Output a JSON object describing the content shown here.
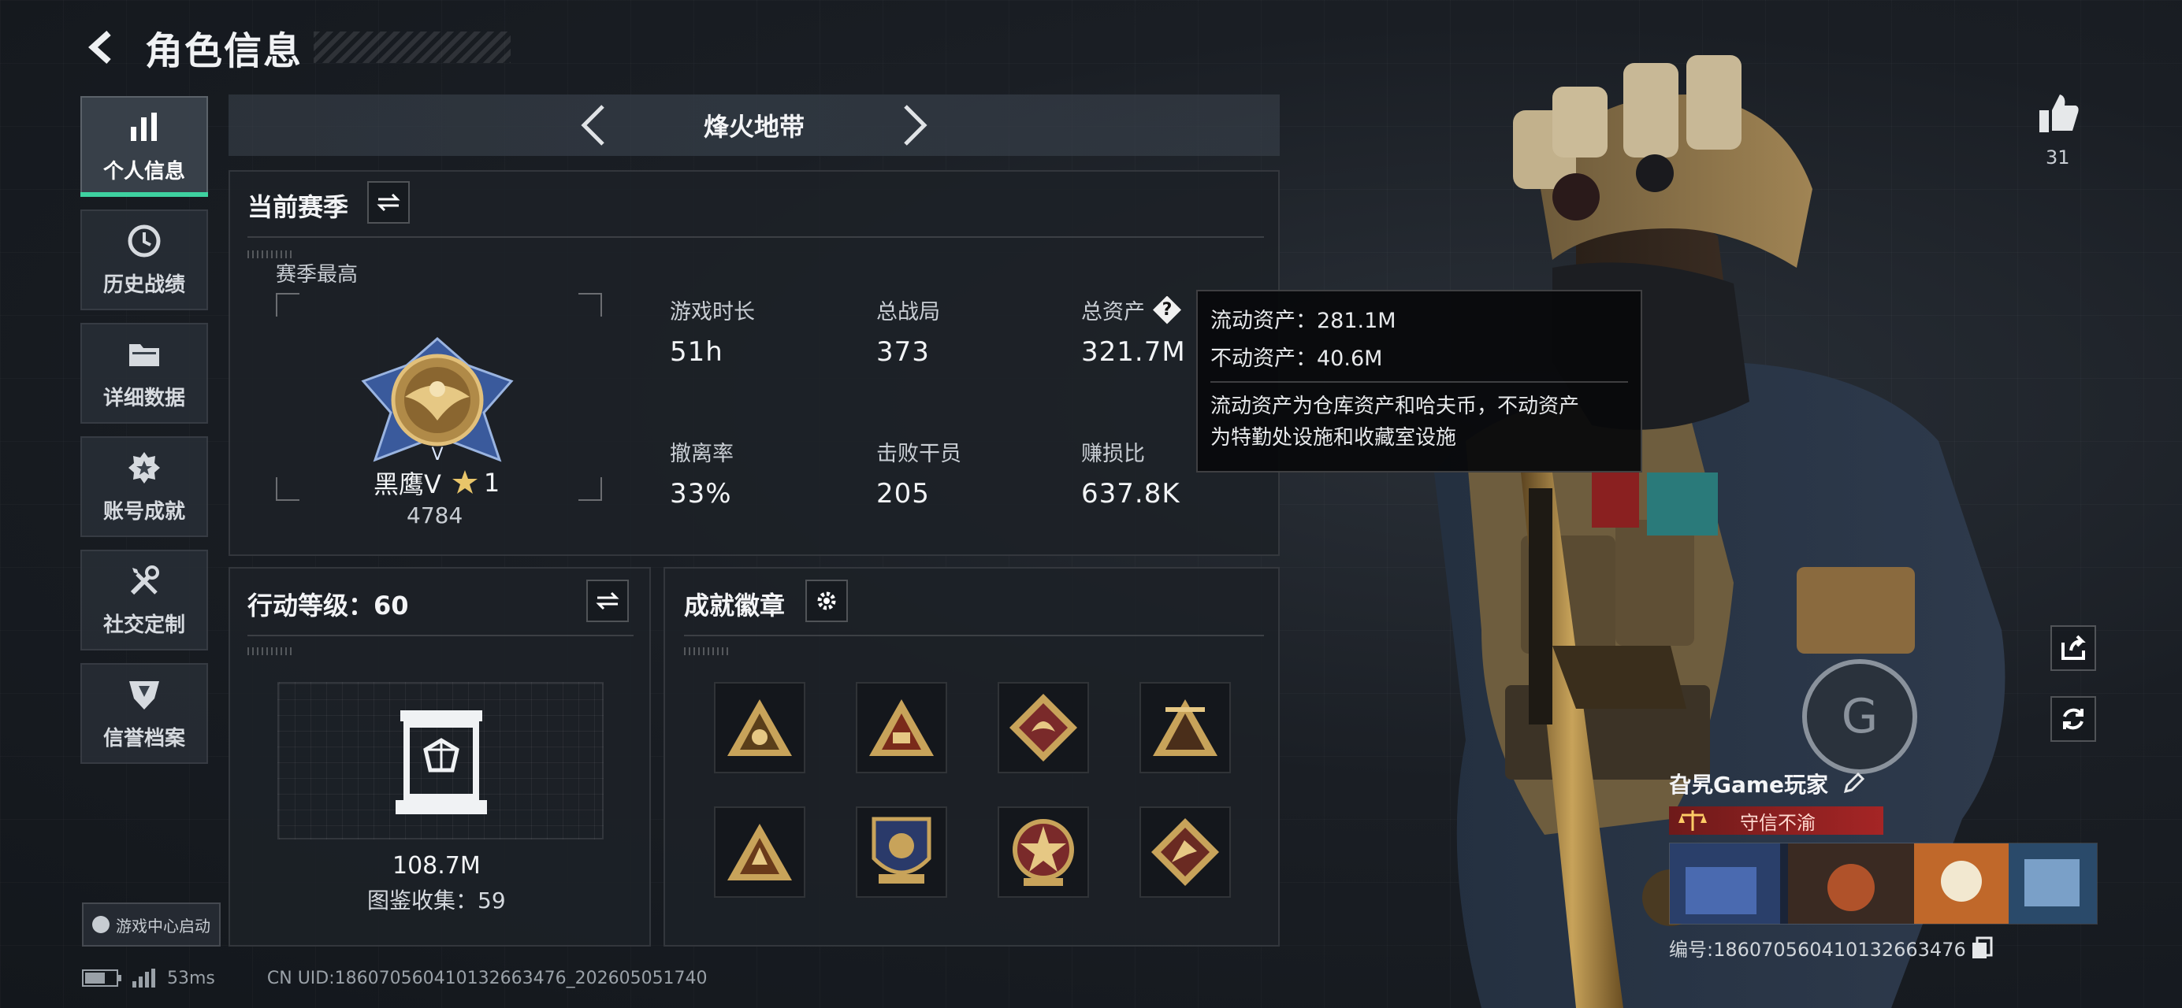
{
  "header": {
    "title": "角色信息"
  },
  "sidebar": {
    "items": [
      {
        "label": "个人信息",
        "icon": "bar-chart-icon"
      },
      {
        "label": "历史战绩",
        "icon": "clock-icon"
      },
      {
        "label": "详细数据",
        "icon": "folder-icon"
      },
      {
        "label": "账号成就",
        "icon": "medal-icon"
      },
      {
        "label": "社交定制",
        "icon": "tools-icon"
      },
      {
        "label": "信誉档案",
        "icon": "shield-icon"
      }
    ],
    "launch_label": "游戏中心启动"
  },
  "mode": {
    "title": "烽火地带"
  },
  "season": {
    "title": "当前赛季",
    "best_label": "赛季最高",
    "rank_name": "黑鹰V",
    "rank_stars": "1",
    "rank_points": "4784",
    "stats": [
      {
        "label": "游戏时长",
        "value": "51h"
      },
      {
        "label": "总战局",
        "value": "373"
      },
      {
        "label": "总资产",
        "value": "321.7M"
      },
      {
        "label": "撤离率",
        "value": "33%"
      },
      {
        "label": "击败干员",
        "value": "205"
      },
      {
        "label": "赚损比",
        "value": "637.8K"
      }
    ]
  },
  "tooltip": {
    "line1": "流动资产：281.1M",
    "line2": "不动资产：40.6M",
    "desc1": "流动资产为仓库资产和哈夫币，不动资产",
    "desc2": "为特勤处设施和收藏室设施"
  },
  "level": {
    "title": "行动等级：60",
    "value": "108.7M",
    "collection": "图鉴收集：59"
  },
  "achievements": {
    "title": "成就徽章",
    "badges": [
      "badge-1",
      "badge-2",
      "badge-3",
      "badge-4",
      "badge-5",
      "badge-6",
      "badge-7",
      "badge-8"
    ]
  },
  "likes": {
    "count": "31"
  },
  "player": {
    "name": "旮旯Game玩家",
    "credit": "守信不渝",
    "id_text": "编号:18607056041013266347​6"
  },
  "footer": {
    "ping": "53ms",
    "uid": "CN UID:18607056041013266347​6_202605051740"
  },
  "colors": {
    "accent": "#3ed1a0",
    "credit_red": "#a52525",
    "gold": "#c8a35a"
  }
}
